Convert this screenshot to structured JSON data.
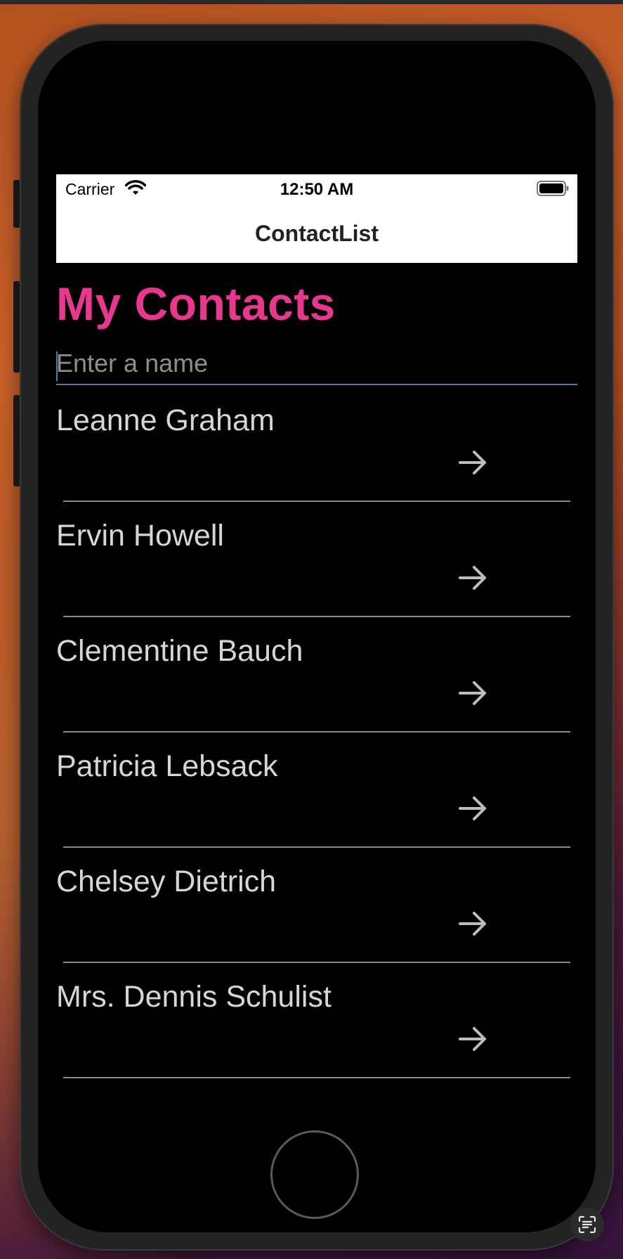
{
  "status_bar": {
    "carrier": "Carrier",
    "time": "12:50 AM"
  },
  "nav": {
    "title": "ContactList"
  },
  "page_title": "My Contacts",
  "search": {
    "placeholder": "Enter a name",
    "value": ""
  },
  "contacts": [
    {
      "name": "Leanne Graham"
    },
    {
      "name": "Ervin Howell"
    },
    {
      "name": "Clementine Bauch"
    },
    {
      "name": "Patricia Lebsack"
    },
    {
      "name": "Chelsey Dietrich"
    },
    {
      "name": "Mrs. Dennis Schulist"
    }
  ],
  "icons": {
    "row_action": "arrow-right-icon",
    "wifi": "wifi-icon",
    "battery": "battery-icon",
    "live_text": "live-text-icon"
  },
  "colors": {
    "title_accent": "#e8388e",
    "input_underline": "#3d86a8",
    "screen_background": "#000000",
    "name_text": "#d6d6d6"
  }
}
